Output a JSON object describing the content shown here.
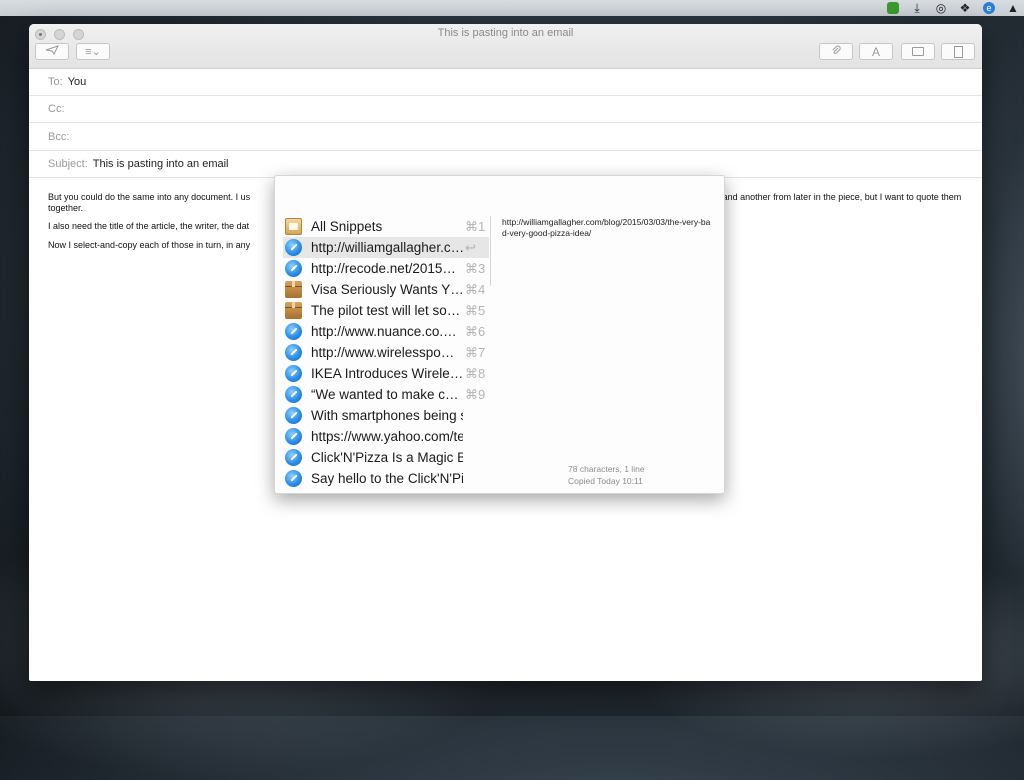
{
  "window": {
    "title": "This is pasting into an email"
  },
  "toolbar": {
    "send_icon": "paper-plane-icon",
    "header_options_icon": "list-icon",
    "attach_icon": "paperclip-icon",
    "format_label": "A",
    "photo_icon": "photo-browser-icon",
    "stationery_icon": "stationery-icon"
  },
  "headers": {
    "to_label": "To:",
    "to_value": "You",
    "cc_label": "Cc:",
    "bcc_label": "Bcc:",
    "subject_label": "Subject:",
    "subject_value": "This is pasting into an email"
  },
  "body": {
    "p1_start": "But you could do the same into any document. I us",
    "p1_end": "here and another from later in the piece, but I want to quote them together.",
    "p2_start": "I also need the title of the article, the writer, the dat",
    "p3_start": "Now I select-and-copy each of those in turn, in any"
  },
  "popup": {
    "items": [
      {
        "label": "All Snippets",
        "shortcut": "⌘1",
        "icon": "snippets-icon"
      },
      {
        "label": "http://williamgallagher.c…",
        "shortcut": "↩",
        "icon": "safari-icon",
        "selected": true
      },
      {
        "label": "http://recode.net/2015…",
        "shortcut": "⌘3",
        "icon": "safari-icon"
      },
      {
        "label": "Visa Seriously Wants Y…",
        "shortcut": "⌘4",
        "icon": "package-icon"
      },
      {
        "label": "The pilot test will let so…",
        "shortcut": "⌘5",
        "icon": "package-icon"
      },
      {
        "label": "http://www.nuance.co.…",
        "shortcut": "⌘6",
        "icon": "safari-icon"
      },
      {
        "label": "http://www.wirelesspo…",
        "shortcut": "⌘7",
        "icon": "safari-icon"
      },
      {
        "label": "IKEA Introduces Wirele…",
        "shortcut": "⌘8",
        "icon": "safari-icon"
      },
      {
        "label": "“We wanted to make c…",
        "shortcut": "⌘9",
        "icon": "safari-icon"
      },
      {
        "label": "With smartphones being su…",
        "shortcut": "",
        "icon": "safari-icon"
      },
      {
        "label": "https://www.yahoo.com/tec…",
        "shortcut": "",
        "icon": "safari-icon"
      },
      {
        "label": "Click'N'Pizza Is a Magic But…",
        "shortcut": "",
        "icon": "safari-icon"
      },
      {
        "label": "Say hello to the Click'N'Pizz…",
        "shortcut": "",
        "icon": "safari-icon"
      }
    ],
    "preview_text": "http://williamgallagher.com/blog/2015/03/03/the-very-bad-very-good-pizza-idea/",
    "meta_chars": "78 characters, 1 line",
    "meta_copied": "Copied Today 10:11"
  },
  "menubar": {
    "icons": [
      "evernote-icon",
      "download-icon",
      "creative-cloud-icon",
      "dropbox-icon",
      "ecamm-icon",
      "notification-icon"
    ]
  }
}
